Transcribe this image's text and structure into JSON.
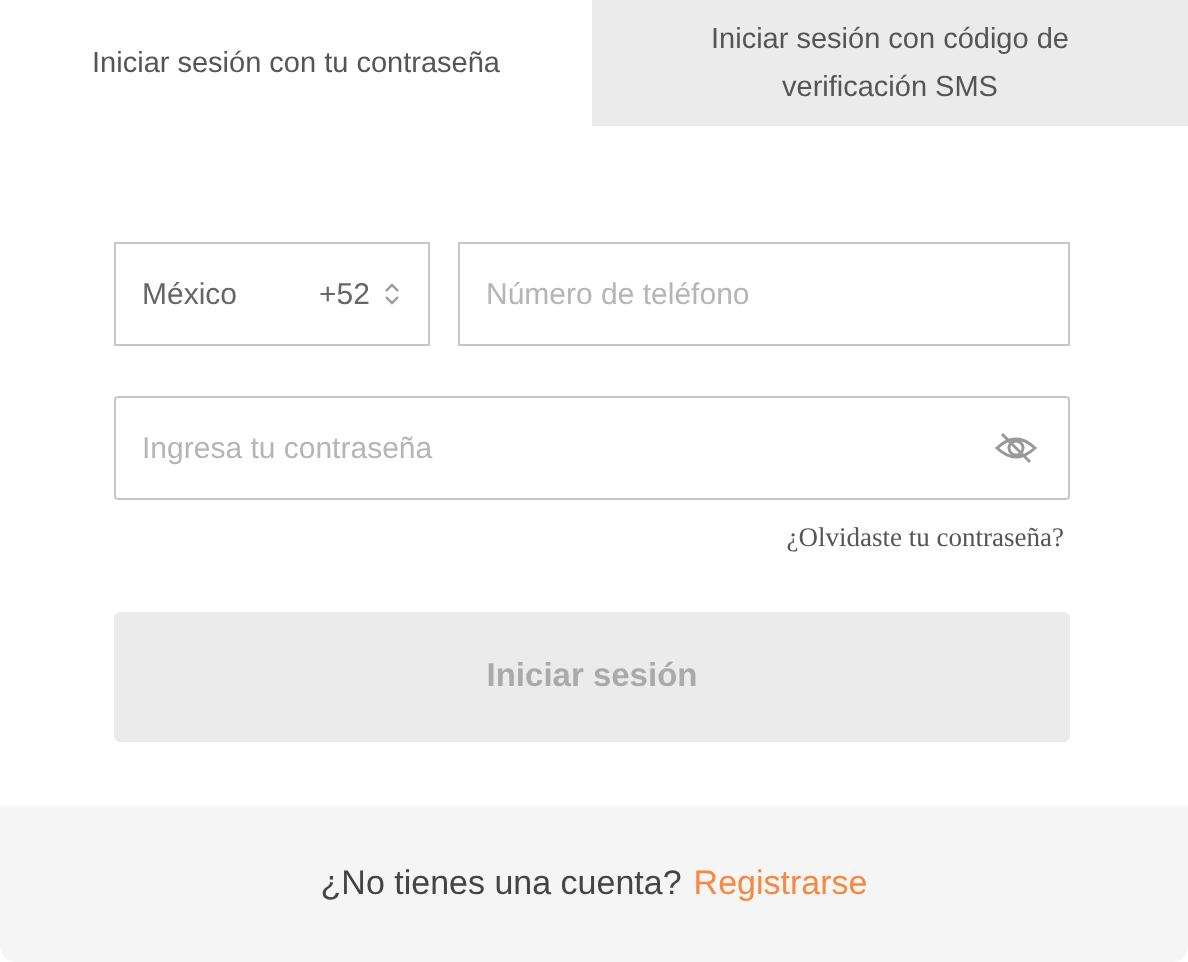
{
  "tabs": [
    {
      "label": "Iniciar sesión con tu contraseña",
      "selected": true
    },
    {
      "label": "Iniciar sesión con código de verificación SMS",
      "selected": false
    }
  ],
  "country_select": {
    "country": "México",
    "code": "+52"
  },
  "phone_field": {
    "placeholder": "Número de teléfono"
  },
  "password_field": {
    "placeholder": "Ingresa tu contraseña",
    "visible": false
  },
  "forgot_link": "¿Olvidaste tu contraseña?",
  "login_button": {
    "label": "Iniciar sesión",
    "disabled": true
  },
  "footer": {
    "prompt": "¿No tienes una cuenta?",
    "link": "Registrarse"
  }
}
